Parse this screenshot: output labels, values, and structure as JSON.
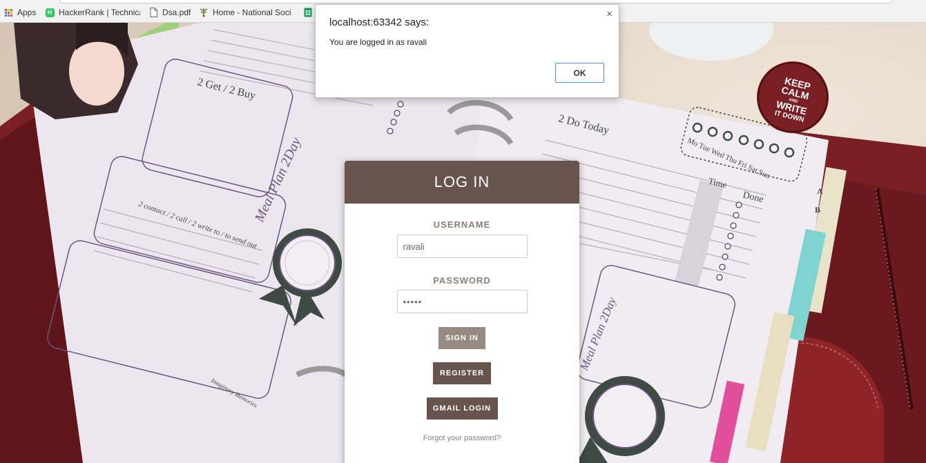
{
  "bookmarks": {
    "items": [
      {
        "label": "Apps",
        "icon": "apps-grid-icon"
      },
      {
        "label": "HackerRank | Technica",
        "icon": "hackerrank-icon"
      },
      {
        "label": "Dsa.pdf",
        "icon": "document-icon"
      },
      {
        "label": "Home - National Soci",
        "icon": "tree-emblem-icon"
      },
      {
        "label": "",
        "icon": "spreadsheet-icon"
      }
    ],
    "hackerrank_badge": "H"
  },
  "scene": {
    "planner_headings": {
      "get_buy": "2 Get / 2 Buy",
      "meal_plan": "Meal Plan 2Day",
      "contact": "2 contact / 2 call / 2 write to / to send out",
      "do_today": "2 Do Today",
      "time": "Time",
      "done": "Done",
      "weekdays": "Mo Tue Wed Thu Fri Sat Sun",
      "signature": "Imaginary Memories",
      "meal_plan_right": "Meal Plan 2Day"
    },
    "badge_text": [
      "KEEP",
      "CALM",
      "AND",
      "WRITE",
      "IT DOWN"
    ],
    "tab_letters": [
      "A",
      "B"
    ]
  },
  "login": {
    "title": "LOG IN",
    "username_label": "USERNAME",
    "username_value": "ravali",
    "password_label": "PASSWORD",
    "password_value": "•••••",
    "signin_label": "SIGN IN",
    "register_label": "REGISTER",
    "gmail_label": "GMAIL LOGIN",
    "forgot_label": "Forgot your password?"
  },
  "alert": {
    "title": "localhost:63342 says:",
    "message": "You are logged in as ravali",
    "ok_label": "OK",
    "close_glyph": "×"
  },
  "colors": {
    "header_brown": "#66544d",
    "signin_taupe": "#978a83",
    "label_gray": "#8c7f79",
    "planner_purple": "#6e5480",
    "folder_red": "#7a1f23",
    "alert_focus_blue": "#4d90fe"
  }
}
